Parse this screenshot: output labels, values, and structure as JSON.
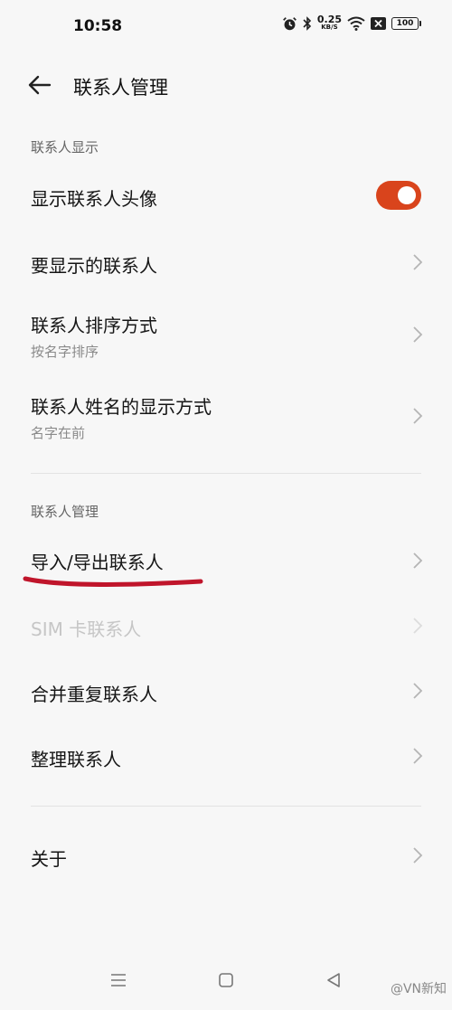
{
  "status_bar": {
    "time": "10:58",
    "net_speed_value": "0.25",
    "net_speed_unit": "KB/S",
    "battery": "100",
    "icons": [
      "alarm-icon",
      "bluetooth-icon",
      "wifi-icon",
      "sim-off-icon",
      "battery-icon"
    ]
  },
  "appbar": {
    "title": "联系人管理",
    "back_icon": "arrow-left-icon"
  },
  "sections": [
    {
      "header": "联系人显示",
      "items": [
        {
          "label": "显示联系人头像",
          "control": "toggle",
          "on": true,
          "accent": "#d9441c"
        },
        {
          "label": "要显示的联系人"
        },
        {
          "label": "联系人排序方式",
          "sub": "按名字排序"
        },
        {
          "label": "联系人姓名的显示方式",
          "sub": "名字在前"
        }
      ]
    },
    {
      "header": "联系人管理",
      "items": [
        {
          "label": "导入/导出联系人"
        },
        {
          "label": "SIM 卡联系人",
          "disabled": true
        },
        {
          "label": "合并重复联系人"
        },
        {
          "label": "整理联系人"
        }
      ]
    },
    {
      "items": [
        {
          "label": "关于"
        }
      ]
    }
  ],
  "navbar": {
    "icons": [
      "menu-icon",
      "home-icon",
      "back-triangle-icon"
    ]
  },
  "watermark": "@VN新知",
  "annotation_color": "#c0152b"
}
